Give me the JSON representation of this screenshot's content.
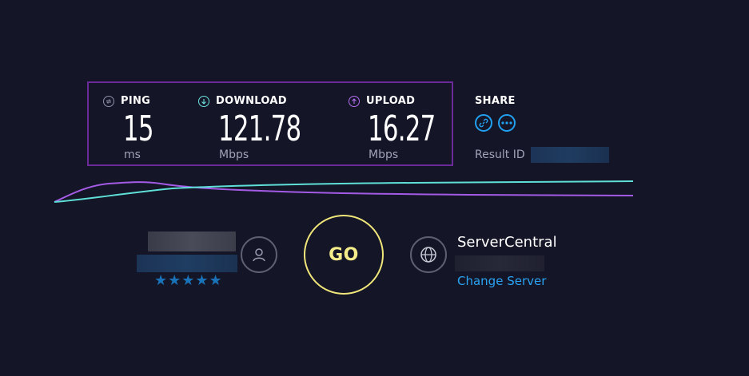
{
  "metrics": {
    "ping": {
      "label": "PING",
      "value": "15",
      "unit": "ms",
      "icon": "ping-icon",
      "color": "#8e91a6"
    },
    "download": {
      "label": "DOWNLOAD",
      "value": "121.78",
      "unit": "Mbps",
      "icon": "download-arrow-icon",
      "color": "#6de3df"
    },
    "upload": {
      "label": "UPLOAD",
      "value": "16.27",
      "unit": "Mbps",
      "icon": "upload-arrow-icon",
      "color": "#b36ef0"
    }
  },
  "share": {
    "label": "SHARE",
    "link_icon": "link-icon",
    "more_icon": "more-icon",
    "result_id_label": "Result ID"
  },
  "provider": {
    "rating_stars": 5,
    "stars_text": "★★★★★",
    "icon": "user-icon"
  },
  "go_button": {
    "label": "GO"
  },
  "server": {
    "name": "ServerCentral",
    "change_label": "Change Server",
    "icon": "globe-icon"
  },
  "colors": {
    "background": "#141526",
    "download_line": "#5ee0d8",
    "upload_line": "#a35be6",
    "go_ring": "#f0e67a",
    "link": "#2aa3f2",
    "highlight_border": "#6b2a9a"
  }
}
